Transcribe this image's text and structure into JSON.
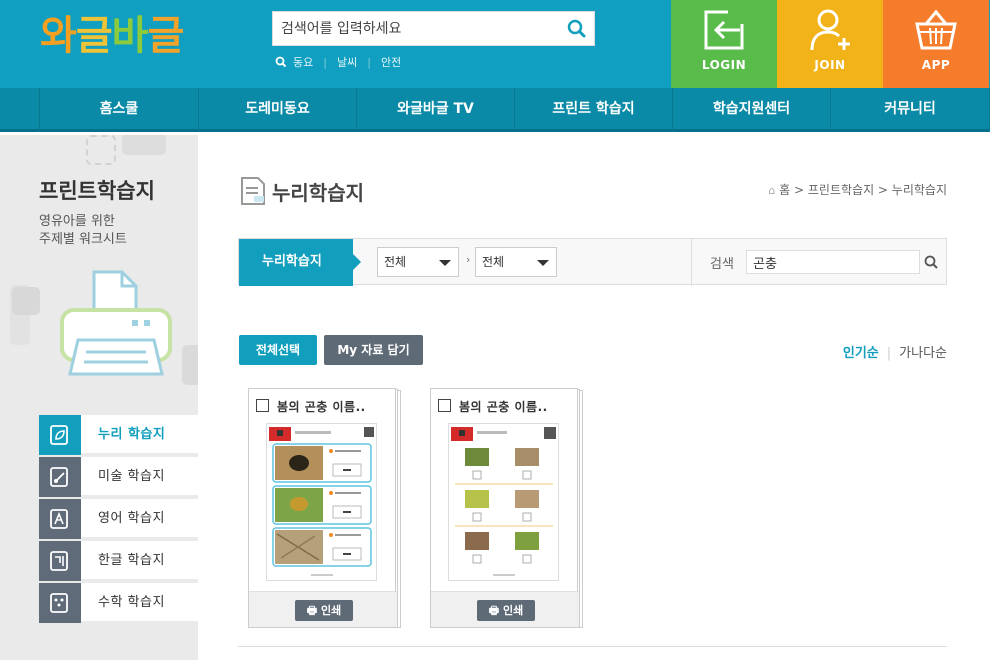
{
  "logo": {
    "chars": [
      "와",
      "글",
      "바",
      "글"
    ],
    "colors": [
      "#f5a021",
      "#e9c03a",
      "#8ccb3e",
      "#f2a32b"
    ]
  },
  "search": {
    "placeholder": "검색어를 입력하세요",
    "quick_links": [
      "동요",
      "날씨",
      "안전"
    ]
  },
  "tiles": [
    {
      "label": "LOGIN",
      "color": "#58bb4a",
      "icon": "login-icon"
    },
    {
      "label": "JOIN",
      "color": "#f2b318",
      "icon": "user-plus-icon"
    },
    {
      "label": "APP",
      "color": "#f47c2b",
      "icon": "basket-icon"
    }
  ],
  "nav": [
    "홈스쿨",
    "도레미동요",
    "와글바글 TV",
    "프린트 학습지",
    "학습지원센터",
    "커뮤니티"
  ],
  "sidebar": {
    "title": "프린트학습지",
    "desc": [
      "영유아를 위한",
      "주제별 워크시트"
    ],
    "items": [
      {
        "label": "누리 학습지",
        "icon": "leaf-icon"
      },
      {
        "label": "미술 학습지",
        "icon": "brush-icon"
      },
      {
        "label": "영어 학습지",
        "icon": "letter-a-icon"
      },
      {
        "label": "한글 학습지",
        "icon": "hangul-icon"
      },
      {
        "label": "수학 학습지",
        "icon": "dice-icon"
      }
    ]
  },
  "page": {
    "title": "누리학습지",
    "breadcrumb": "홈 > 프린트학습지 > 누리학습지"
  },
  "filter": {
    "tab": "누리학습지",
    "select1": "전체",
    "select2": "전체",
    "search_label": "검색",
    "search_value": "곤충"
  },
  "actions": {
    "select_all": "전체선택",
    "save": "My 자료 담기",
    "select_all_color": "#129ebd",
    "save_color": "#5e6a76"
  },
  "sort": {
    "active": "인기순",
    "other": "가나다순"
  },
  "cards": [
    {
      "title": "봄의 곤충 이름..",
      "print": "인쇄"
    },
    {
      "title": "봄의 곤충 이름..",
      "print": "인쇄"
    }
  ]
}
